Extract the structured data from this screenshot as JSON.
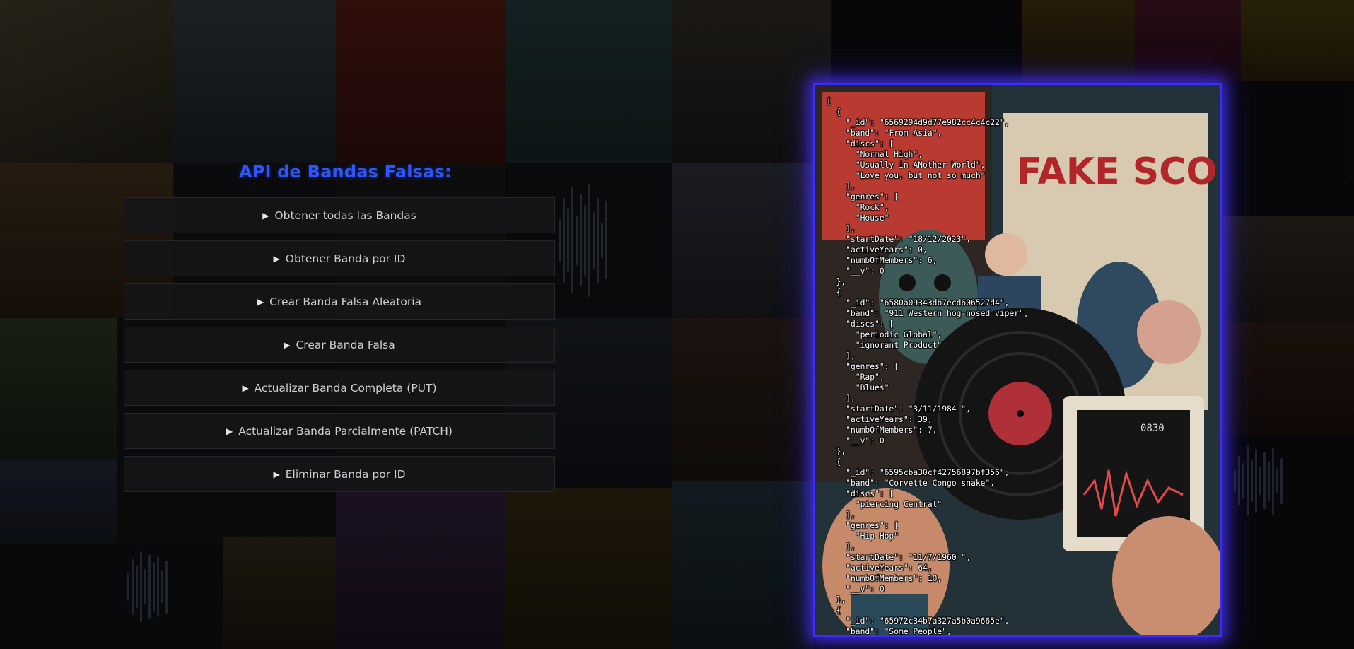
{
  "page": {
    "title": "API de Bandas Falsas:"
  },
  "menu": [
    {
      "label": "Obtener todas las Bandas"
    },
    {
      "label": "Obtener Banda por ID"
    },
    {
      "label": "Crear Banda Falsa Aleatoria"
    },
    {
      "label": "Crear Banda Falsa"
    },
    {
      "label": "Actualizar Banda Completa (PUT)"
    },
    {
      "label": "Actualizar Banda Parcialmente (PATCH)"
    },
    {
      "label": "Eliminar Banda por ID"
    }
  ],
  "colors": {
    "title": "#2d56ff",
    "panel_glow": "#3a2cff",
    "menu_bg": "#161618"
  },
  "icons": {
    "menu_marker": "disclosure-triangle-right"
  },
  "response": {
    "json_text": "[\n  {\n    \"_id\": \"6569294d9d77e982cc4c4c22\",\n    \"band\": \"From Asia\",\n    \"discs\": [\n      \"Normal High\",\n      \"Usually in ANother World\",\n      \"Love you, but not so much\"\n    ],\n    \"genres\": [\n      \"Rock\",\n      \"House\"\n    ],\n    \"startDate\": \"18/12/2023\",\n    \"activeYears\": 0,\n    \"numbOfMembers\": 6,\n    \"__v\": 0\n  },\n  {\n    \"_id\": \"6580a09343db7ecd606527d4\",\n    \"band\": \"911 Western hog-nosed viper\",\n    \"discs\": [\n      \"periodic Global\",\n      \"ignorant Product\"\n    ],\n    \"genres\": [\n      \"Rap\",\n      \"Blues\"\n    ],\n    \"startDate\": \"3/11/1984 \",\n    \"activeYears\": 39,\n    \"numbOfMembers\": 7,\n    \"__v\": 0\n  },\n  {\n    \"_id\": \"6595cba30cf42756897bf356\",\n    \"band\": \"Corvette Congo snake\",\n    \"discs\": [\n      \"piercing Central\"\n    ],\n    \"genres\": [\n      \"Hip Hop\"\n    ],\n    \"startDate\": \"11/7/1960 \",\n    \"activeYears\": 64,\n    \"numbOfMembers\": 10,\n    \"__v\": 0\n  },\n  {\n    \"_id\": \"65972c34b7a327a5b0a9665e\",\n    \"band\": \"Some People\","
  }
}
